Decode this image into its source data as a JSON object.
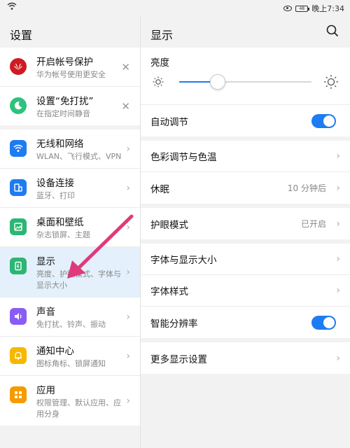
{
  "statusbar": {
    "battery": "48",
    "time": "晚上7:34"
  },
  "left": {
    "title": "设置",
    "top_items": [
      {
        "title": "开启帐号保护",
        "sub": "华为帐号使用更安全",
        "icon": "huawei-icon",
        "color": "#cf1b22"
      },
      {
        "title": "设置“免打扰”",
        "sub": "在指定时间静音",
        "icon": "moon-icon",
        "color": "#2ec27e"
      }
    ],
    "items": [
      {
        "title": "无线和网络",
        "sub": "WLAN、飞行模式、VPN",
        "icon": "wifi-icon",
        "color": "#1e7cf2"
      },
      {
        "title": "设备连接",
        "sub": "蓝牙、打印",
        "icon": "devices-icon",
        "color": "#1e7cf2"
      },
      {
        "title": "桌面和壁纸",
        "sub": "杂志锁屏、主题",
        "icon": "wallpaper-icon",
        "color": "#2bb673"
      },
      {
        "title": "显示",
        "sub": "亮度、护眼模式、字体与显示大小",
        "icon": "display-icon",
        "color": "#2bb673"
      },
      {
        "title": "声音",
        "sub": "免打扰、铃声、振动",
        "icon": "sound-icon",
        "color": "#8a5cf6"
      },
      {
        "title": "通知中心",
        "sub": "图标角标、锁屏通知",
        "icon": "bell-icon",
        "color": "#f5b800"
      },
      {
        "title": "应用",
        "sub": "权限管理、默认应用、应用分身",
        "icon": "apps-icon",
        "color": "#f59a00"
      }
    ]
  },
  "right": {
    "title": "显示",
    "brightness": {
      "label": "亮度",
      "level": 0.29
    },
    "auto_adjust": {
      "label": "自动调节",
      "on": true
    },
    "color_temp": {
      "label": "色彩调节与色温"
    },
    "sleep": {
      "label": "休眠",
      "value": "10 分钟后"
    },
    "eye_comfort": {
      "label": "护眼模式",
      "value": "已开启"
    },
    "font_size": {
      "label": "字体与显示大小"
    },
    "font_style": {
      "label": "字体样式"
    },
    "smart_resolution": {
      "label": "智能分辨率",
      "on": true
    },
    "more": {
      "label": "更多显示设置"
    }
  },
  "accent": "#1e7cf2",
  "annotation_color": "#e03a7a"
}
